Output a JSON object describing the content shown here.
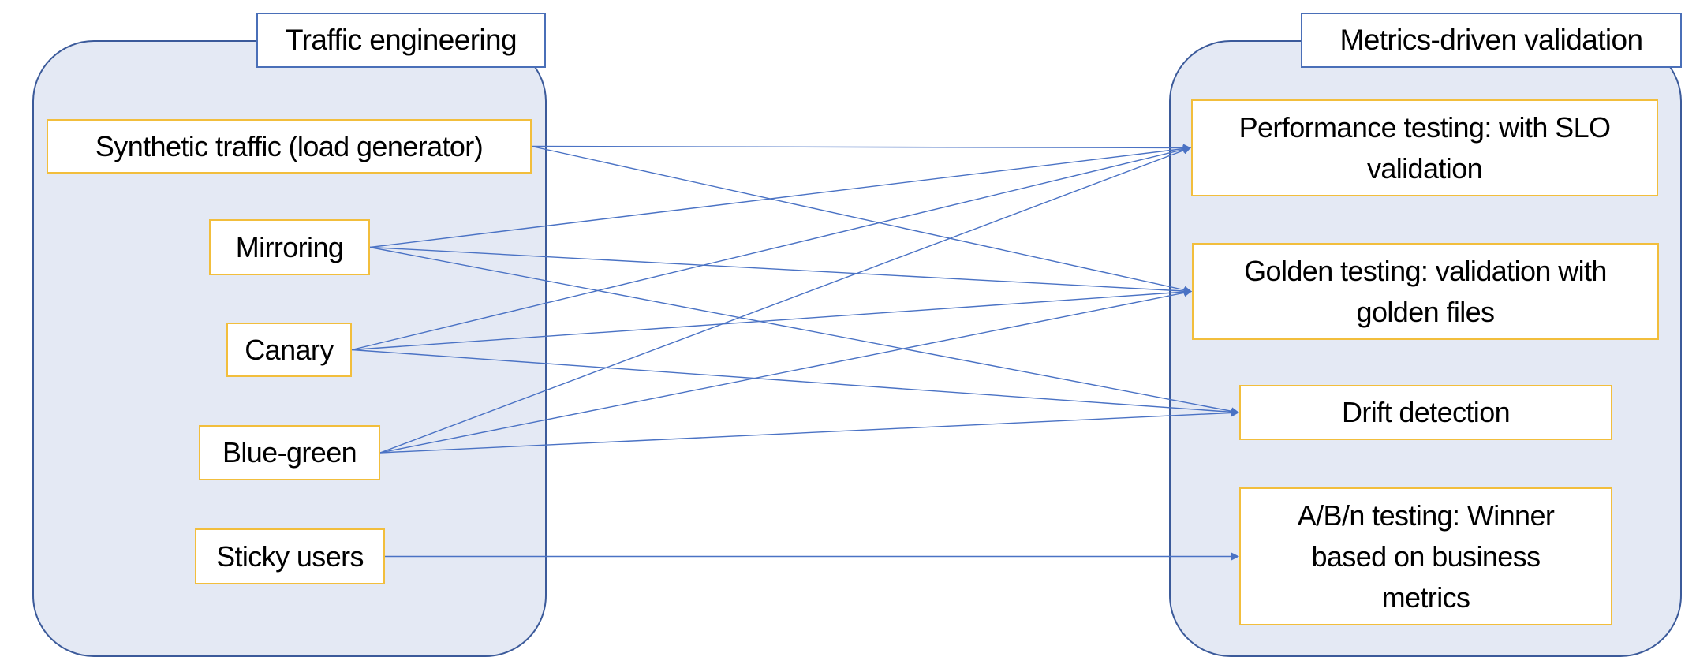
{
  "colors": {
    "container_fill": "#E4E9F4",
    "container_border": "#3B5A9A",
    "node_border": "#F2BE3C",
    "edge": "#4A72C4"
  },
  "groups": {
    "left": {
      "title": "Traffic engineering"
    },
    "right": {
      "title": "Metrics-driven validation"
    }
  },
  "sources": [
    {
      "id": "synthetic",
      "label": "Synthetic traffic (load generator)"
    },
    {
      "id": "mirroring",
      "label": "Mirroring"
    },
    {
      "id": "canary",
      "label": "Canary"
    },
    {
      "id": "bluegreen",
      "label": "Blue-green"
    },
    {
      "id": "sticky",
      "label": "Sticky users"
    }
  ],
  "targets": [
    {
      "id": "perf",
      "label": "Performance testing: with SLO validation"
    },
    {
      "id": "golden",
      "label": "Golden testing: validation with golden files"
    },
    {
      "id": "drift",
      "label": "Drift detection"
    },
    {
      "id": "ab",
      "label": "A/B/n testing: Winner based on business metrics"
    }
  ],
  "edges": [
    {
      "from": "synthetic",
      "to": "perf"
    },
    {
      "from": "synthetic",
      "to": "golden"
    },
    {
      "from": "mirroring",
      "to": "perf"
    },
    {
      "from": "mirroring",
      "to": "golden"
    },
    {
      "from": "mirroring",
      "to": "drift"
    },
    {
      "from": "canary",
      "to": "perf"
    },
    {
      "from": "canary",
      "to": "golden"
    },
    {
      "from": "canary",
      "to": "drift"
    },
    {
      "from": "bluegreen",
      "to": "perf"
    },
    {
      "from": "bluegreen",
      "to": "golden"
    },
    {
      "from": "bluegreen",
      "to": "drift"
    },
    {
      "from": "sticky",
      "to": "ab"
    }
  ]
}
